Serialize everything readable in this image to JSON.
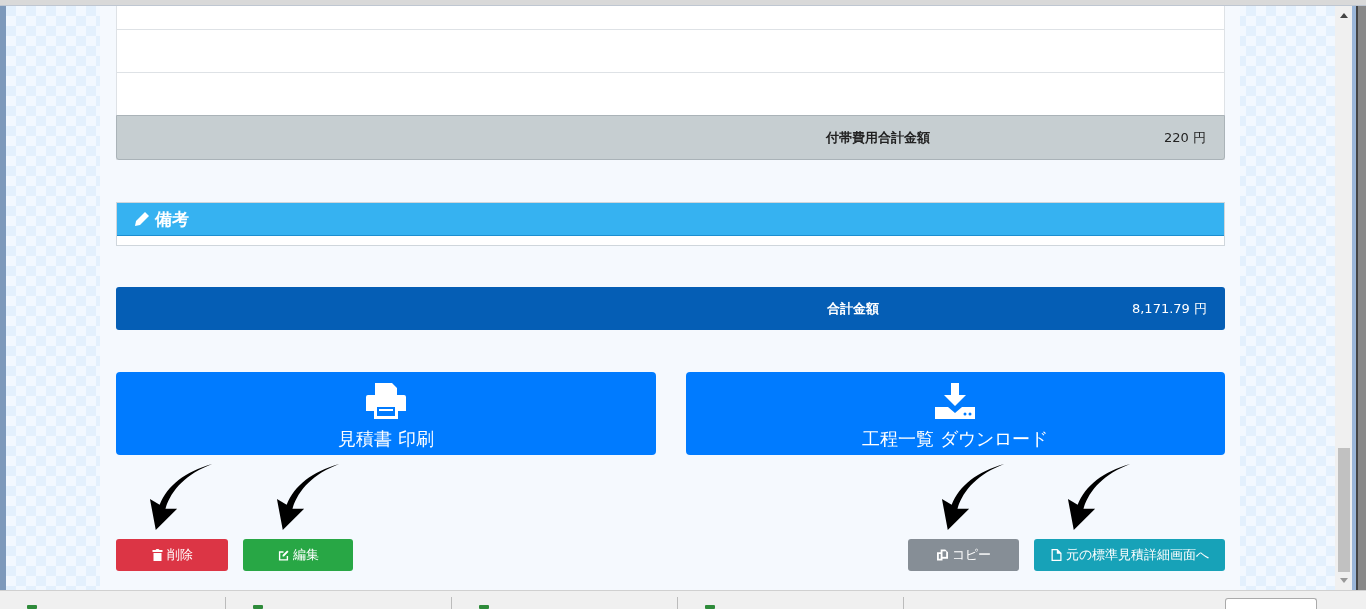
{
  "fees_total": {
    "label": "付帯費用合計金額",
    "amount": "220 円"
  },
  "remarks": {
    "title": "備考"
  },
  "grand_total": {
    "label": "合計金額",
    "amount": "8,171.79 円"
  },
  "big_buttons": [
    {
      "kind": "print",
      "label": "見積書 印刷"
    },
    {
      "kind": "download",
      "label": "工程一覧 ダウンロード"
    }
  ],
  "left_actions": [
    {
      "kind": "delete",
      "label": "削除"
    },
    {
      "kind": "edit",
      "label": "編集"
    }
  ],
  "right_actions": [
    {
      "kind": "copy",
      "label": "コピー"
    },
    {
      "kind": "standard",
      "label": "元の標準見積詳細画面へ"
    }
  ]
}
